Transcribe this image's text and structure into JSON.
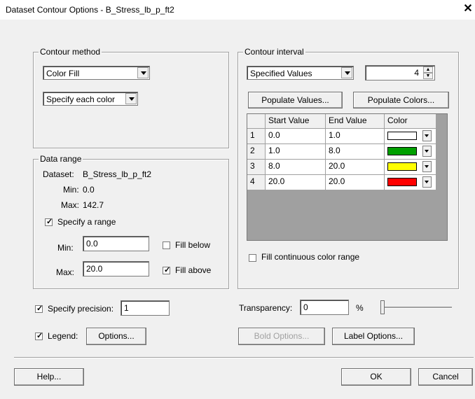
{
  "window": {
    "title": "Dataset Contour Options - B_Stress_lb_p_ft2",
    "close": "✕"
  },
  "contour_method": {
    "label": "Contour method",
    "method_value": "Color Fill",
    "color_mode_value": "Specify each color"
  },
  "data_range": {
    "label": "Data range",
    "dataset_label": "Dataset:",
    "dataset_value": "B_Stress_lb_p_ft2",
    "min_label": "Min:",
    "min_value": "0.0",
    "max_label": "Max:",
    "max_value": "142.7",
    "specify_range_label": "Specify a range",
    "specify_range_checked": true,
    "range_min_label": "Min:",
    "range_min_value": "0.0",
    "range_max_label": "Max:",
    "range_max_value": "20.0",
    "fill_below_label": "Fill below",
    "fill_below_checked": false,
    "fill_above_label": "Fill above",
    "fill_above_checked": true
  },
  "contour_interval": {
    "label": "Contour interval",
    "mode_value": "Specified Values",
    "count_value": "4",
    "populate_values_label": "Populate Values...",
    "populate_colors_label": "Populate Colors...",
    "table": {
      "headers": [
        "",
        "Start Value",
        "End Value",
        "Color"
      ],
      "rows": [
        {
          "index": "1",
          "start": "0.0",
          "end": "1.0",
          "color": "#ffffff"
        },
        {
          "index": "2",
          "start": "1.0",
          "end": "8.0",
          "color": "#00a000"
        },
        {
          "index": "3",
          "start": "8.0",
          "end": "20.0",
          "color": "#ffff00"
        },
        {
          "index": "4",
          "start": "20.0",
          "end": "20.0",
          "color": "#ff0000"
        }
      ]
    },
    "fill_continuous_label": "Fill continuous color range",
    "fill_continuous_checked": false
  },
  "precision": {
    "label": "Specify precision:",
    "checked": true,
    "value": "1"
  },
  "legend": {
    "label": "Legend:",
    "checked": true,
    "options_label": "Options..."
  },
  "transparency": {
    "label": "Transparency:",
    "value": "0",
    "unit": "%",
    "slider_value": 0
  },
  "bold_options_label": "Bold Options...",
  "label_options_label": "Label Options...",
  "footer": {
    "help_label": "Help...",
    "ok_label": "OK",
    "cancel_label": "Cancel"
  }
}
